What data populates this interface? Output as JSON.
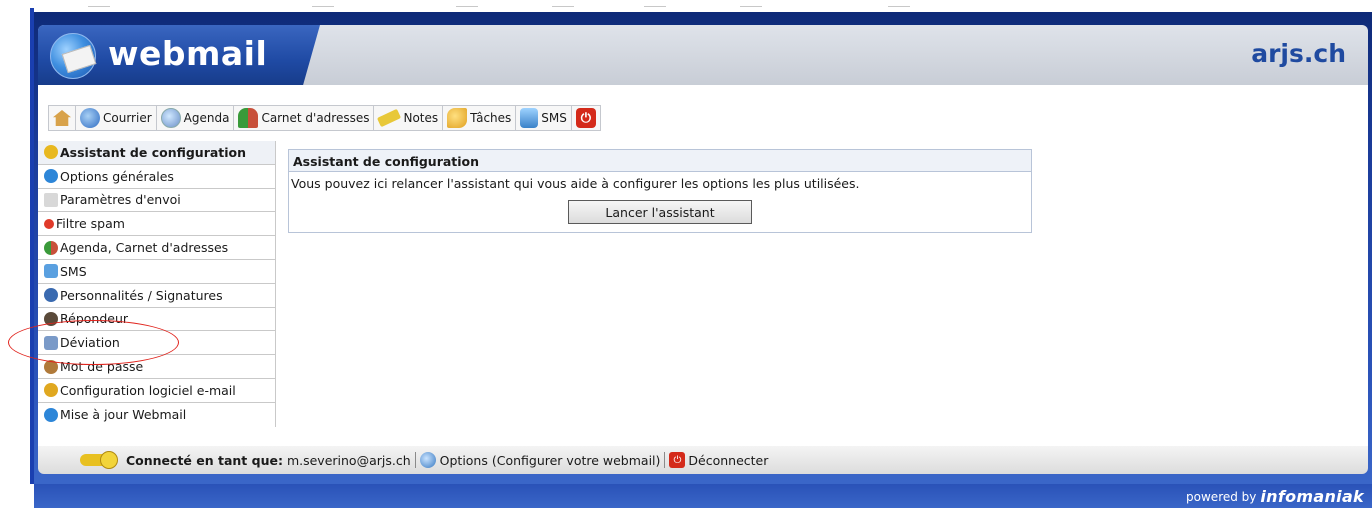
{
  "header": {
    "logo_text": "webmail",
    "brand": "arjs.ch"
  },
  "toolbar": {
    "items": [
      {
        "label": "",
        "icon": "home-icon"
      },
      {
        "label": "Courrier",
        "icon": "mail-icon"
      },
      {
        "label": "Agenda",
        "icon": "agenda-icon"
      },
      {
        "label": "Carnet d'adresses",
        "icon": "contacts-icon"
      },
      {
        "label": "Notes",
        "icon": "notes-icon"
      },
      {
        "label": "Tâches",
        "icon": "tasks-icon"
      },
      {
        "label": "SMS",
        "icon": "sms-icon"
      },
      {
        "label": "",
        "icon": "power-icon"
      }
    ]
  },
  "sidebar": {
    "items": [
      {
        "label": "Assistant de configuration",
        "icon": "wizard-icon",
        "active": true
      },
      {
        "label": "Options générales",
        "icon": "options-icon"
      },
      {
        "label": "Paramètres d'envoi",
        "icon": "send-icon"
      },
      {
        "label": "Filtre spam",
        "icon": "spam-icon"
      },
      {
        "label": "Agenda, Carnet d'adresses",
        "icon": "agenda-contacts-icon"
      },
      {
        "label": "SMS",
        "icon": "sms-icon"
      },
      {
        "label": "Personnalités / Signatures",
        "icon": "signature-icon"
      },
      {
        "label": "Répondeur",
        "icon": "responder-icon"
      },
      {
        "label": "Déviation",
        "icon": "forward-icon"
      },
      {
        "label": "Mot de passe",
        "icon": "password-icon"
      },
      {
        "label": "Configuration logiciel e-mail",
        "icon": "email-client-icon"
      },
      {
        "label": "Mise à jour Webmail",
        "icon": "update-icon"
      }
    ]
  },
  "panel": {
    "title": "Assistant de configuration",
    "description": "Vous pouvez ici relancer l'assistant qui vous aide à configurer les options les plus utilisées.",
    "button_label": "Lancer l'assistant"
  },
  "status": {
    "connected_label": "Connecté en tant que:",
    "user": "m.severino@arjs.ch",
    "options_label": "Options (Configurer votre webmail)",
    "logout_label": "Déconnecter"
  },
  "footer": {
    "powered_by": "powered by",
    "provider": "infomaniak"
  },
  "colors": {
    "frame_blue": "#1b3c9a",
    "brand_blue": "#1f4aa0",
    "annotation_red": "#e0231c"
  }
}
